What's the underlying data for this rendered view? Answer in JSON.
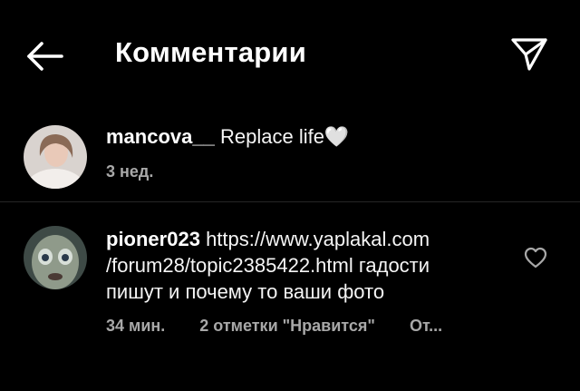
{
  "header": {
    "title": "Комментарии",
    "back_icon": "arrow-left-icon",
    "send_icon": "paper-plane-icon"
  },
  "caption": {
    "username": "mancova__",
    "text": "Replace life🤍",
    "time": "3 нед."
  },
  "comments": [
    {
      "username": "pioner023",
      "text_line1": "https://www.yaplakal.com",
      "text_line2": "/forum28/topic2385422.html  гадости",
      "text_line3": "пишут и почему то ваши фото",
      "time": "34 мин.",
      "likes": "2 отметки \"Нравится\"",
      "reply": "От..."
    }
  ],
  "colors": {
    "background": "#000000",
    "text": "#ffffff",
    "secondary": "#a8a8a8",
    "divider": "#262626"
  }
}
